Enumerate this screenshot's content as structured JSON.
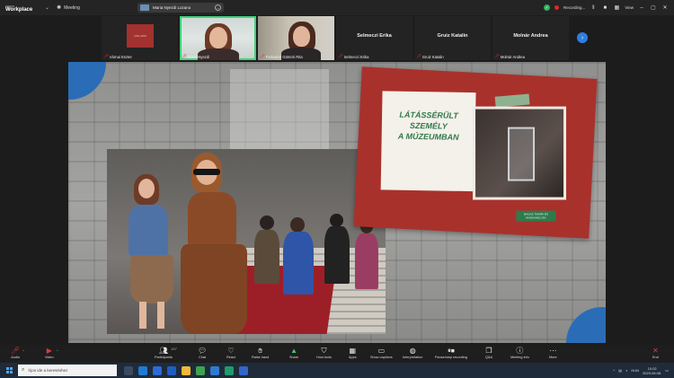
{
  "app": {
    "brand_line1": "zoom",
    "brand_line2": "Workplace",
    "meeting_label": "Meeting",
    "speaker_pill": "Maria Nyezdi Lozano",
    "recording_label": "Recording...",
    "view_label": "View"
  },
  "participants": [
    {
      "name": "Várnai Eszter",
      "type": "logo",
      "logo_text": "CSIL MÚZ"
    },
    {
      "name": "Mária Nyezdi",
      "type": "camera",
      "active": true
    },
    {
      "name": "Farkasné Gömöri Rita",
      "type": "camera"
    },
    {
      "name": "Selmeczi Erika",
      "type": "name"
    },
    {
      "name": "Gruiz Katalin",
      "type": "name"
    },
    {
      "name": "Molnár Andrea",
      "type": "name"
    }
  ],
  "slide": {
    "title_line1": "LÁTÁSSÉRÜLT SZEMÉLY",
    "title_line2": "A MÚZEUMBAN",
    "caption": "MAGAS TANÁRI ÉS MUNKAHELYEK"
  },
  "toolbar": {
    "items": [
      {
        "label": "Audio",
        "icon": "mic-muted-icon"
      },
      {
        "label": "Video",
        "icon": "video-off-icon"
      },
      {
        "label": "Participants",
        "icon": "participants-icon",
        "count": "157"
      },
      {
        "label": "Chat",
        "icon": "chat-icon"
      },
      {
        "label": "React",
        "icon": "heart-icon"
      },
      {
        "label": "Raise hand",
        "icon": "hand-icon"
      },
      {
        "label": "Share",
        "icon": "share-icon"
      },
      {
        "label": "Host tools",
        "icon": "shield-icon"
      },
      {
        "label": "Apps",
        "icon": "apps-icon"
      },
      {
        "label": "Show captions",
        "icon": "cc-icon"
      },
      {
        "label": "Interpretation",
        "icon": "globe-icon"
      },
      {
        "label": "Pause/stop recording",
        "icon": "record-icon"
      },
      {
        "label": "Q&A",
        "icon": "qa-icon"
      },
      {
        "label": "Meeting info",
        "icon": "info-icon"
      },
      {
        "label": "More",
        "icon": "more-icon"
      },
      {
        "label": "End",
        "icon": "end-icon"
      }
    ]
  },
  "taskbar": {
    "search_placeholder": "Írjon ide a kereséshez",
    "language": "HUN",
    "time": "10:02",
    "date": "2023.06.06."
  }
}
